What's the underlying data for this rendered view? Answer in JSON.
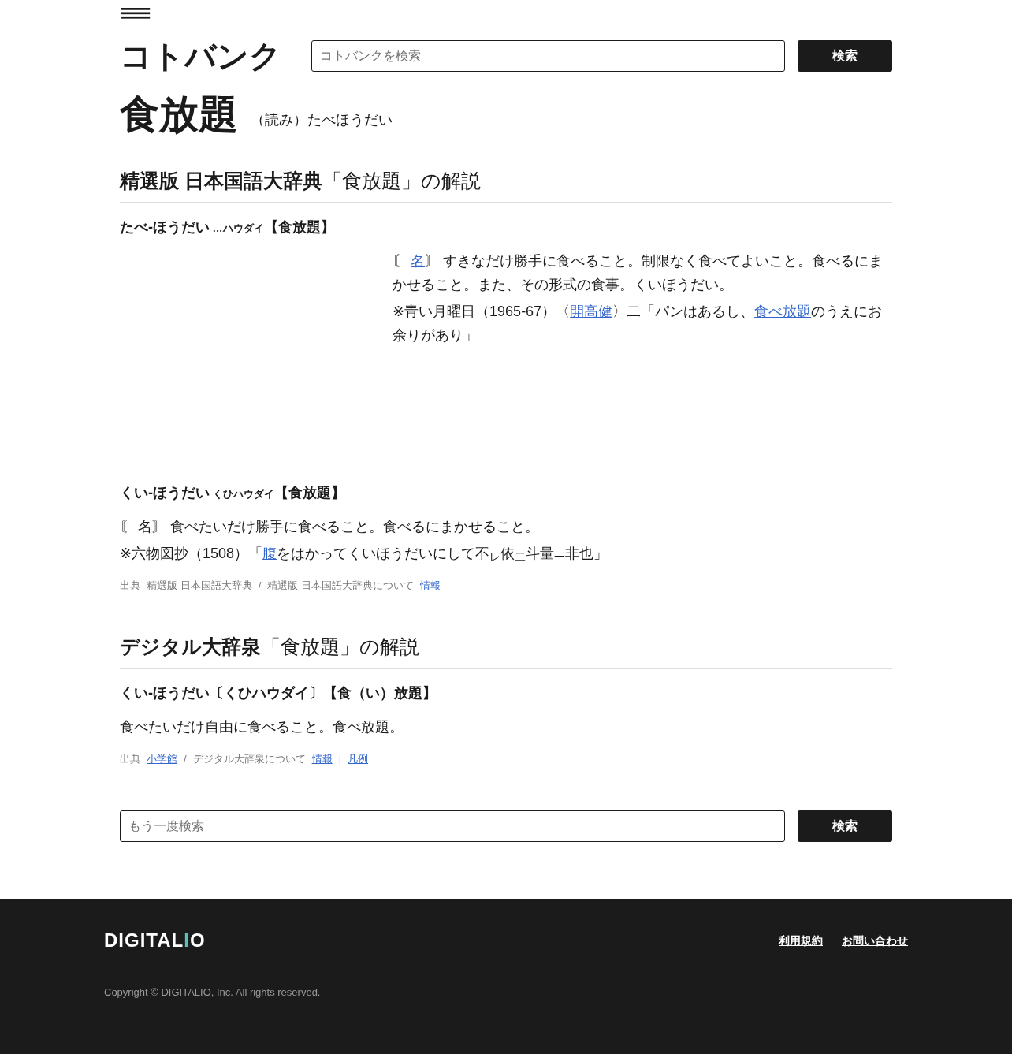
{
  "header": {
    "logo": "コトバンク",
    "search": {
      "placeholder": "コトバンクを検索",
      "button": "検索"
    }
  },
  "title": {
    "word": "食放題",
    "reading": "（読み）たべほうだい"
  },
  "sections": [
    {
      "dictionary": "精選版 日本国語大辞典",
      "suffix": "「食放題」の解説",
      "entries": [
        {
          "headword": "たべ-ほうだい",
          "kana": "…ハウダイ",
          "kanji": "【食放題】",
          "kind": "offset",
          "paragraphs": [
            [
              {
                "text": "〘 ",
                "link": false
              },
              {
                "text": "名",
                "link": true
              },
              {
                "text": "〙 すきなだけ勝手に食べること。制限なく食べてよいこと。食べるにまかせること。また、その形式の食事。くいほうだい。",
                "link": false
              }
            ],
            [
              {
                "text": "※青い月曜日（1965-67）〈",
                "link": false
              },
              {
                "text": "開高健",
                "link": true
              },
              {
                "text": "〉二「パンはあるし、",
                "link": false
              },
              {
                "text": "食べ放題",
                "link": true
              },
              {
                "text": "のうえにお余りがあり」",
                "link": false
              }
            ]
          ]
        },
        {
          "headword": "くい-ほうだい",
          "kana": "くひハウダイ",
          "kanji": "【食放題】",
          "kind": "full",
          "paragraphs": [
            [
              {
                "text": "〘 名〙 食べたいだけ勝手に食べること。食べるにまかせること。",
                "link": false
              }
            ],
            [
              {
                "text": "※六物図抄（1508）「",
                "link": false
              },
              {
                "text": "腹",
                "link": true
              },
              {
                "text": "をはかってくいほうだいにして不$_{レ}$依$_{二}$斗量$_{一}$非也」",
                "link": false
              }
            ]
          ]
        }
      ],
      "source": [
        {
          "text": "出典",
          "link": false
        },
        {
          "text": "精選版 日本国語大辞典",
          "link": false
        },
        {
          "text": "/",
          "link": false
        },
        {
          "text": "精選版 日本国語大辞典について",
          "link": false
        },
        {
          "text": "情報",
          "link": true
        }
      ]
    },
    {
      "dictionary": "デジタル大辞泉",
      "suffix": "「食放題」の解説",
      "entries": [
        {
          "headword": "くい-ほうだい〔くひハウダイ〕【食（い）放題】",
          "kind": "full",
          "paragraphs": [
            [
              {
                "text": "食べたいだけ自由に食べること。食べ放題。",
                "link": false
              }
            ]
          ]
        }
      ],
      "source": [
        {
          "text": "出典",
          "link": false
        },
        {
          "text": "小学館",
          "link": true
        },
        {
          "text": "/",
          "link": false
        },
        {
          "text": "デジタル大辞泉について",
          "link": false
        },
        {
          "text": "情報",
          "link": true
        },
        {
          "text": "|",
          "link": false
        },
        {
          "text": "凡例",
          "link": true
        }
      ]
    }
  ],
  "bottom_search": {
    "placeholder": "もう一度検索",
    "button": "検索"
  },
  "footer": {
    "logo": "DIGITALIO",
    "links": [
      "利用規約",
      "お問い合わせ"
    ],
    "copyright": "Copyright © DIGITALIO, Inc. All rights reserved."
  }
}
